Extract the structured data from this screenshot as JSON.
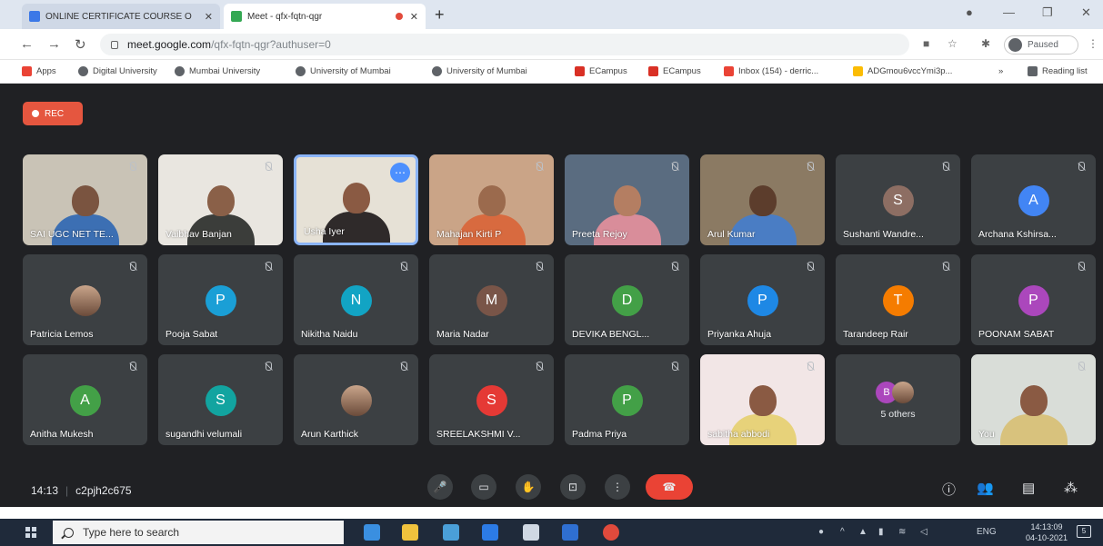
{
  "browser": {
    "tabs": [
      {
        "label": "ONLINE CERTIFICATE COURSE O",
        "favicon_color": "#3b78e7"
      },
      {
        "label": "Meet - qfx-fqtn-qgr",
        "favicon_color": "#34a853"
      }
    ],
    "new_tab": "+",
    "address": {
      "host": "meet.google.com",
      "path": "/qfx-fqtn-qgr?authuser=0"
    },
    "profile": "Paused",
    "bookmarks": [
      {
        "label": "Apps",
        "color": "#ea4335"
      },
      {
        "label": "Digital University",
        "color": "#5f6368"
      },
      {
        "label": "Mumbai University",
        "color": "#5f6368"
      },
      {
        "label": "University of Mumbai",
        "color": "#5f6368"
      },
      {
        "label": "University of Mumbai",
        "color": "#5f6368"
      },
      {
        "label": "ECampus",
        "color": "#d93025"
      },
      {
        "label": "ECampus",
        "color": "#d93025"
      },
      {
        "label": "Inbox (154) - derric...",
        "color": "#ea4335"
      },
      {
        "label": "ADGmou6vccYmi3p...",
        "color": "#fbbc04"
      }
    ],
    "bookmarks_more": "»",
    "reading_list": "Reading list"
  },
  "meet": {
    "rec_label": "REC",
    "participants": [
      {
        "name": "SAI UGC NET TE...",
        "kind": "video",
        "skin": "#7a5440",
        "shirt": "#3c6fb3",
        "bg": "#c9c3b6"
      },
      {
        "name": "Vaibhav Banjan",
        "kind": "video",
        "skin": "#8a6048",
        "shirt": "#3b3d3a",
        "bg": "#e9e6e0"
      },
      {
        "name": "Usha Iyer",
        "kind": "video",
        "skin": "#8a5a43",
        "shirt": "#2f2a2a",
        "bg": "#e6e1d6",
        "active": true
      },
      {
        "name": "Mahajan Kirti P",
        "kind": "video",
        "skin": "#9b6a4d",
        "shirt": "#d86a3f",
        "bg": "#caa487"
      },
      {
        "name": "Preeta Rejoy",
        "kind": "video",
        "skin": "#b47e62",
        "shirt": "#d98d9a",
        "bg": "#5a6c80"
      },
      {
        "name": "Arul Kumar",
        "kind": "video",
        "skin": "#5c3d2c",
        "shirt": "#4a7dc4",
        "bg": "#8b7a63"
      },
      {
        "name": "Sushanti Wandre...",
        "kind": "avatar",
        "initial": "S",
        "color": "#8d6e63"
      },
      {
        "name": "Archana Kshirsa...",
        "kind": "avatar",
        "initial": "A",
        "color": "#4285f4"
      },
      {
        "name": "Patricia Lemos",
        "kind": "photo"
      },
      {
        "name": "Pooja Sabat",
        "kind": "avatar",
        "initial": "P",
        "color": "#1a9fd6"
      },
      {
        "name": "Nikitha Naidu",
        "kind": "avatar",
        "initial": "N",
        "color": "#12a4c4"
      },
      {
        "name": "Maria Nadar",
        "kind": "avatar",
        "initial": "M",
        "color": "#795548"
      },
      {
        "name": "DEVIKA BENGL...",
        "kind": "avatar",
        "initial": "D",
        "color": "#43a047"
      },
      {
        "name": "Priyanka Ahuja",
        "kind": "avatar",
        "initial": "P",
        "color": "#1e88e5"
      },
      {
        "name": "Tarandeep Rair",
        "kind": "avatar",
        "initial": "T",
        "color": "#f57c00"
      },
      {
        "name": "POONAM SABAT",
        "kind": "avatar",
        "initial": "P",
        "color": "#ab47bc"
      },
      {
        "name": "Anitha Mukesh",
        "kind": "avatar",
        "initial": "A",
        "color": "#43a047"
      },
      {
        "name": "sugandhi velumali",
        "kind": "avatar",
        "initial": "S",
        "color": "#12a4a0"
      },
      {
        "name": "Arun Karthick",
        "kind": "photo"
      },
      {
        "name": "SREELAKSHMI V...",
        "kind": "avatar",
        "initial": "S",
        "color": "#e53935"
      },
      {
        "name": "Padma Priya",
        "kind": "avatar",
        "initial": "P",
        "color": "#43a047"
      },
      {
        "name": "sabitha abbodi",
        "kind": "video",
        "skin": "#8a5a43",
        "shirt": "#e7d27a",
        "bg": "#f2e6e6"
      },
      {
        "name": "5 others",
        "kind": "others",
        "first_initial": "B",
        "first_color": "#ab47bc"
      },
      {
        "name": "You",
        "kind": "video",
        "skin": "#8a5a43",
        "shirt": "#d8c27d",
        "bg": "#d9ddd8"
      }
    ],
    "time": "14:13",
    "meeting_code": "c2pjh2c675",
    "controls": [
      {
        "name": "microphone-icon",
        "glyph": "🎤"
      },
      {
        "name": "camera-icon",
        "glyph": "▭"
      },
      {
        "name": "raise-hand-icon",
        "glyph": "✋"
      },
      {
        "name": "present-screen-icon",
        "glyph": "⊡"
      },
      {
        "name": "more-options-icon",
        "glyph": "⋮"
      }
    ],
    "hangup_glyph": "☎",
    "side_controls": [
      {
        "name": "meeting-details-icon",
        "glyph": "ⓘ"
      },
      {
        "name": "people-icon",
        "glyph": "👥"
      },
      {
        "name": "chat-icon",
        "glyph": "▤"
      },
      {
        "name": "activities-icon",
        "glyph": "⁂"
      }
    ]
  },
  "taskbar": {
    "search_placeholder": "Type here to search",
    "apps": [
      "#3a8fe0",
      "#f0c23d",
      "#4a9fd8",
      "#2c7be5",
      "#cfd8e3",
      "#2f6fd1",
      "#e04a3c"
    ],
    "lang": "ENG",
    "clock_time": "14:13:09",
    "clock_date": "04-10-2021",
    "notification_count": "5"
  }
}
